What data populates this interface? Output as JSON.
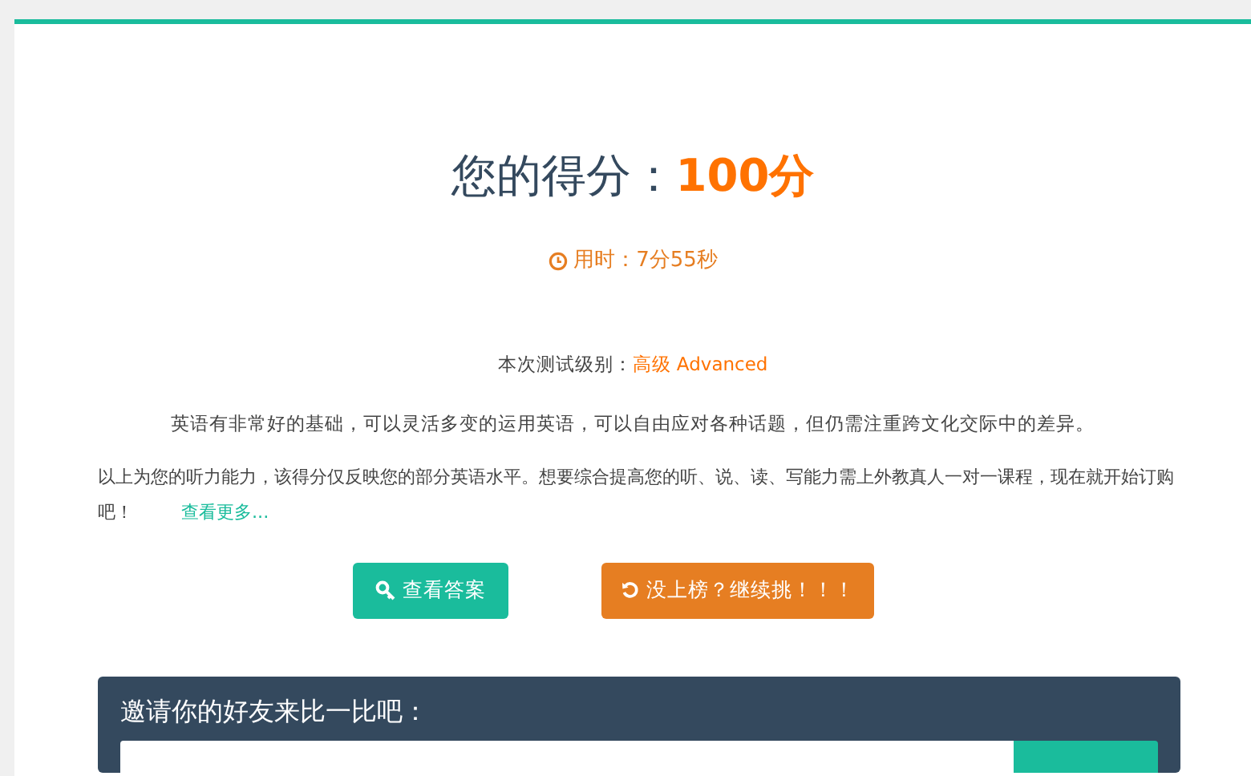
{
  "result": {
    "title": "您的得分：",
    "score": "100分",
    "time": "用时：7分55秒"
  },
  "level": {
    "label": "本次测试级别：",
    "value": "高级 Advanced"
  },
  "description": "英语有非常好的基础，可以灵活多变的运用英语，可以自由应对各种话题，但仍需注重跨文化交际中的差异。",
  "note": "以上为您的听力能力，该得分仅反映您的部分英语水平。想要综合提高您的听、说、读、写能力需上外教真人一对一课程，现在就开始订购吧！",
  "more_link": "查看更多...",
  "buttons": [
    {
      "kind": "answers",
      "label": "查看答案"
    },
    {
      "kind": "retry",
      "label": "没上榜？继续挑！！！"
    }
  ],
  "invite": {
    "title": "邀请你的好友来比一比吧："
  }
}
